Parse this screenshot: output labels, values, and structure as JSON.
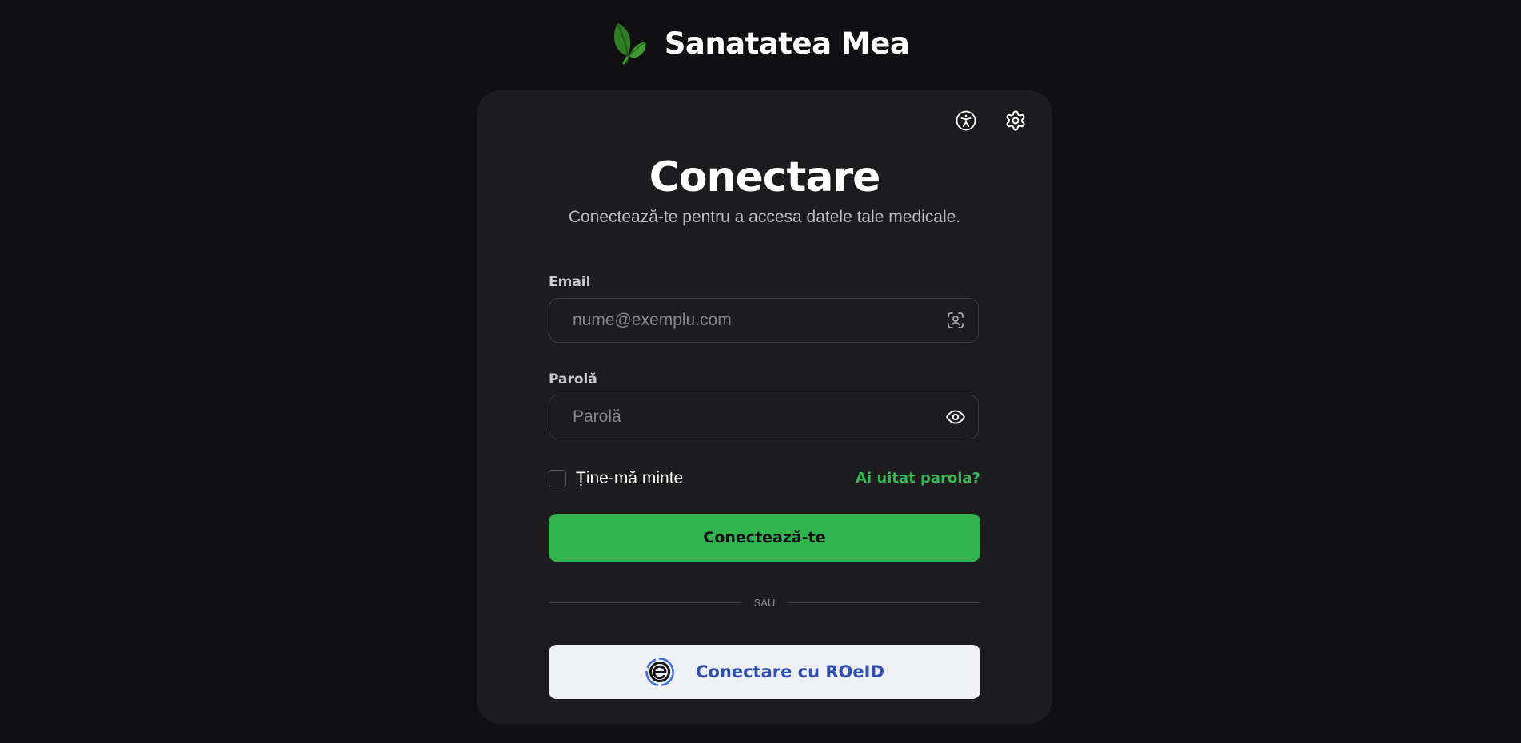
{
  "brand": {
    "title": "Sanatatea Mea",
    "logo_icon": "leaf-icon",
    "logo_color": "#3a8f2a"
  },
  "toolbar": {
    "accessibility_icon": "accessibility-icon",
    "settings_icon": "gear-icon"
  },
  "login": {
    "title": "Conectare",
    "subtitle": "Conectează-te pentru a accesa datele tale medicale.",
    "email": {
      "label": "Email",
      "placeholder": "nume@exemplu.com",
      "value": "",
      "icon": "contact-scan-icon"
    },
    "password": {
      "label": "Parolă",
      "placeholder": "Parolă",
      "value": "",
      "icon": "eye-icon"
    },
    "remember_me": {
      "label": "Ține-mă minte",
      "checked": false
    },
    "forgot_password": "Ai uitat parola?",
    "submit_label": "Conectează-te",
    "divider": "SAU",
    "roeid": {
      "label": "Conectare cu ROeID",
      "icon": "roeid-logo-icon"
    }
  },
  "colors": {
    "background": "#101012",
    "card": "#1c1c1f",
    "accent_green": "#31b34f",
    "link_green": "#34b852",
    "roeid_blue": "#2f4fb1",
    "roeid_button": "#eff0f6"
  }
}
